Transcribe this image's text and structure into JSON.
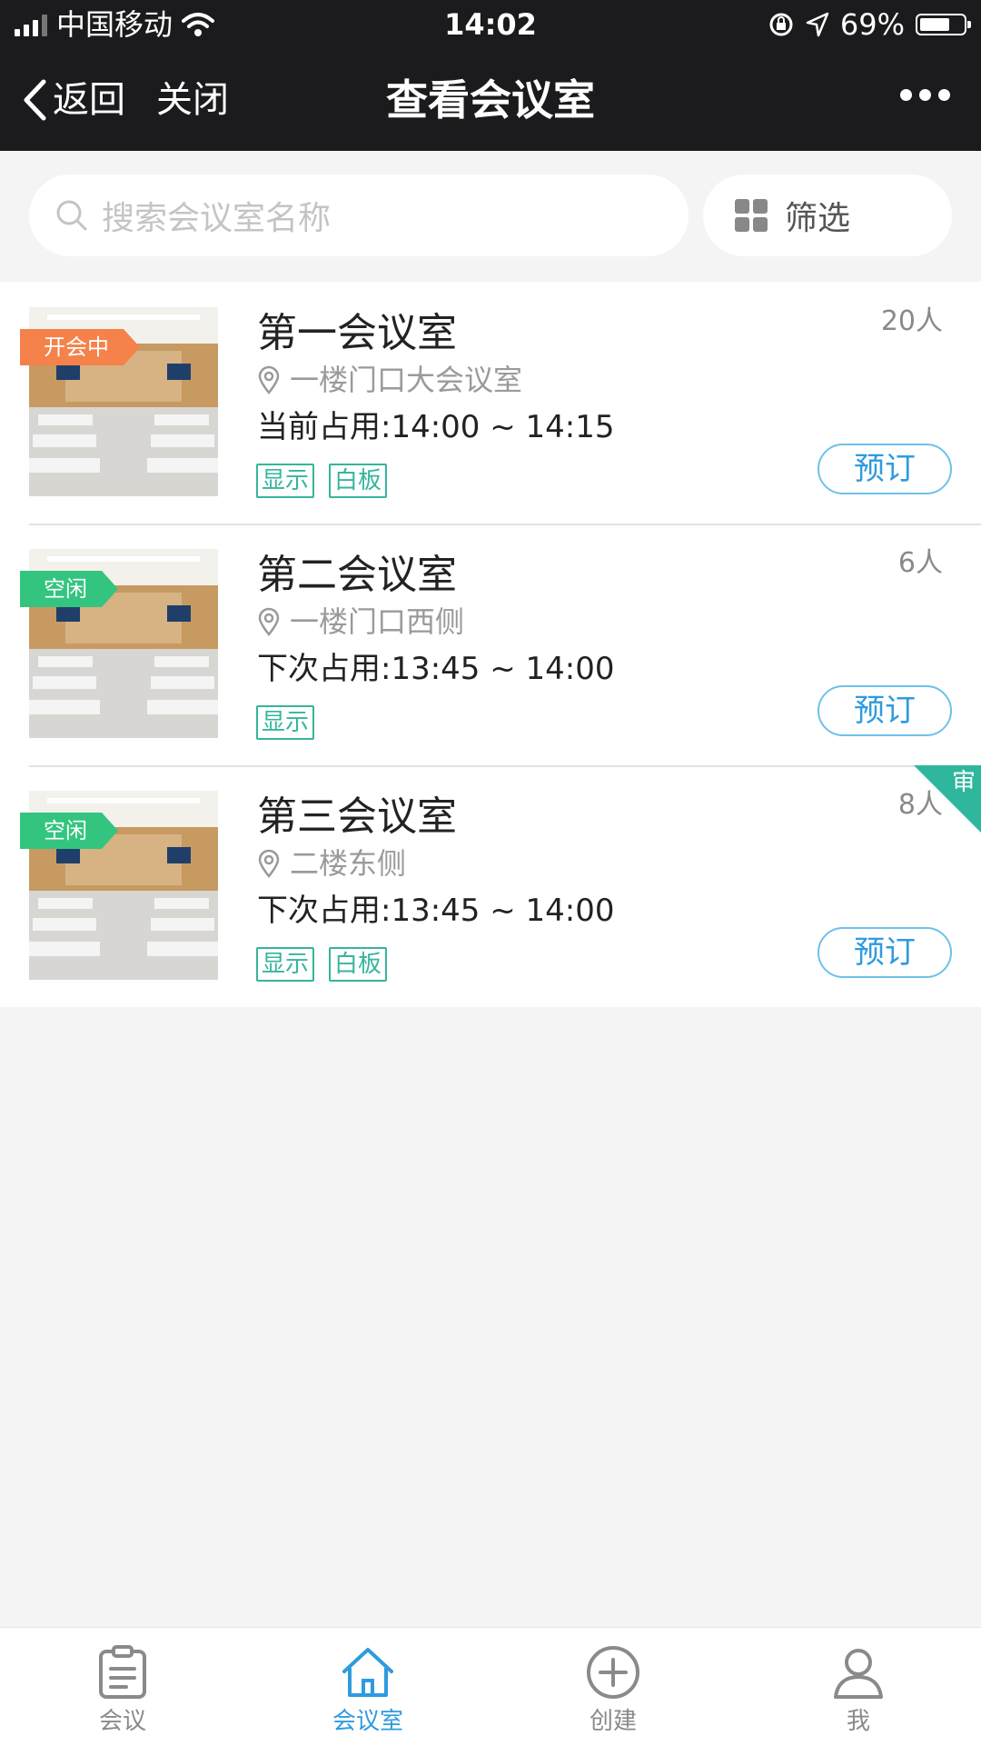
{
  "status_bar": {
    "carrier": "中国移动",
    "time": "14:02",
    "battery": "69%"
  },
  "nav": {
    "back_label": "返回",
    "close_label": "关闭",
    "title": "查看会议室"
  },
  "search": {
    "placeholder": "搜索会议室名称",
    "filter_label": "筛选"
  },
  "rooms": [
    {
      "name": "第一会议室",
      "capacity": "20人",
      "location": "一楼门口大会议室",
      "time": "当前占用:14:00 ~ 14:15",
      "status": "开会中",
      "status_color": "#f5824a",
      "tags": [
        "显示",
        "白板"
      ],
      "book_label": "预订"
    },
    {
      "name": "第二会议室",
      "capacity": "6人",
      "location": "一楼门口西侧",
      "time": "下次占用:13:45 ~ 14:00",
      "status": "空闲",
      "status_color": "#33c57f",
      "tags": [
        "显示"
      ],
      "book_label": "预订"
    },
    {
      "name": "第三会议室",
      "capacity": "8人",
      "location": "二楼东侧",
      "time": "下次占用:13:45 ~ 14:00",
      "status": "空闲",
      "status_color": "#33c57f",
      "tags": [
        "显示",
        "白板"
      ],
      "book_label": "预订",
      "audit_badge": "审"
    }
  ],
  "tabbar": [
    {
      "label": "会议",
      "icon": "clipboard-icon",
      "active": false
    },
    {
      "label": "会议室",
      "icon": "home-icon",
      "active": true
    },
    {
      "label": "创建",
      "icon": "plus-circle-icon",
      "active": false
    },
    {
      "label": "我",
      "icon": "user-icon",
      "active": false
    }
  ],
  "colors": {
    "accent": "#2e9be0",
    "tag": "#36b59d",
    "busy": "#f5824a",
    "free": "#33c57f",
    "dark_bar": "#1b1b1d"
  }
}
